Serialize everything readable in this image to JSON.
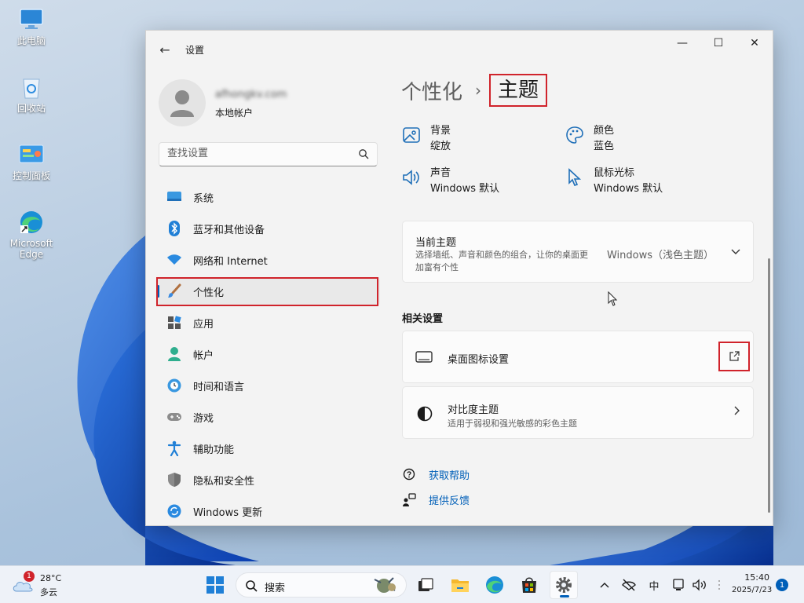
{
  "desktop": {
    "icons": [
      {
        "label": "此电脑",
        "icon": "computer-icon"
      },
      {
        "label": "回收站",
        "icon": "recycle-bin-icon"
      },
      {
        "label": "控制面板",
        "icon": "control-panel-icon"
      },
      {
        "label": "Microsoft Edge",
        "icon": "edge-icon"
      }
    ]
  },
  "window": {
    "title": "设置",
    "controls": {
      "minimize": "—",
      "maximize": "☐",
      "close": "✕"
    },
    "back": "←"
  },
  "sidebar": {
    "profile": {
      "name": "afhongkv.com",
      "type": "本地帐户"
    },
    "search": {
      "placeholder": "查找设置"
    },
    "items": [
      {
        "label": "系统",
        "icon": "monitor-icon",
        "active": false
      },
      {
        "label": "蓝牙和其他设备",
        "icon": "bluetooth-icon",
        "active": false
      },
      {
        "label": "网络和 Internet",
        "icon": "wifi-icon",
        "active": false
      },
      {
        "label": "个性化",
        "icon": "brush-icon",
        "active": true
      },
      {
        "label": "应用",
        "icon": "apps-icon",
        "active": false
      },
      {
        "label": "帐户",
        "icon": "person-icon",
        "active": false
      },
      {
        "label": "时间和语言",
        "icon": "globe-clock-icon",
        "active": false
      },
      {
        "label": "游戏",
        "icon": "gamepad-icon",
        "active": false
      },
      {
        "label": "辅助功能",
        "icon": "accessibility-icon",
        "active": false
      },
      {
        "label": "隐私和安全性",
        "icon": "shield-icon",
        "active": false
      },
      {
        "label": "Windows 更新",
        "icon": "update-icon",
        "active": false
      }
    ]
  },
  "main": {
    "breadcrumb": {
      "parent": "个性化",
      "separator": "›",
      "current": "主题"
    },
    "quick": [
      {
        "title": "背景",
        "value": "绽放",
        "icon": "image-icon"
      },
      {
        "title": "颜色",
        "value": "蓝色",
        "icon": "palette-icon"
      },
      {
        "title": "声音",
        "value": "Windows 默认",
        "icon": "speaker-icon"
      },
      {
        "title": "鼠标光标",
        "value": "Windows 默认",
        "icon": "cursor-icon"
      }
    ],
    "current_theme": {
      "title": "当前主题",
      "description": "选择墙纸、声音和颜色的组合，让你的桌面更加富有个性",
      "value": "Windows（浅色主题）",
      "chevron": "⌄"
    },
    "related_title": "相关设置",
    "desktop_icons": {
      "label": "桌面图标设置",
      "icon": "monitor-outline-icon"
    },
    "contrast": {
      "label": "对比度主题",
      "description": "适用于弱视和强光敏感的彩色主题",
      "chevron": "›"
    },
    "help": {
      "label": "获取帮助"
    },
    "feedback": {
      "label": "提供反馈"
    }
  },
  "taskbar": {
    "weather": {
      "temp": "28°C",
      "desc": "多云",
      "badge": "1"
    },
    "search_label": "搜索",
    "tray": {
      "chevron": "^",
      "ime": "中"
    },
    "clock": {
      "time": "15:40",
      "date": "2025/7/23"
    },
    "notification_count": "1"
  },
  "colors": {
    "accent": "#005fb8",
    "highlight_box": "#d0232b",
    "window_bg": "#f3f3f3",
    "card_bg": "#fbfbfb"
  }
}
